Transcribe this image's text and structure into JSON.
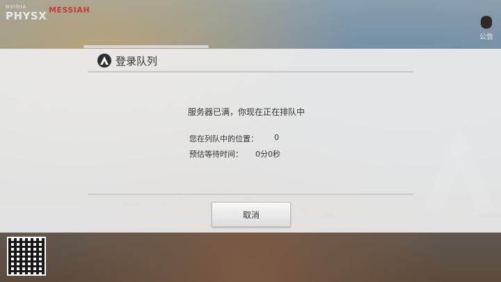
{
  "branding": {
    "nvidia": "NVIDIA",
    "physx": "PHYSX",
    "messiah": "MESSIAH"
  },
  "notice": {
    "label": "公告",
    "icon": "document-icon"
  },
  "dialog": {
    "title": "登录队列",
    "title_icon": "game-logo-icon",
    "message": "服务器已满，你现在正在排队中",
    "position_label": "您在列队中的位置：",
    "position_value": "0",
    "wait_label": "预估等待时间：",
    "wait_value": "0分0秒",
    "cancel_label": "取消"
  },
  "colors": {
    "overlay": "#ececec",
    "text": "#333333",
    "messiah_red": "#c9393b"
  }
}
